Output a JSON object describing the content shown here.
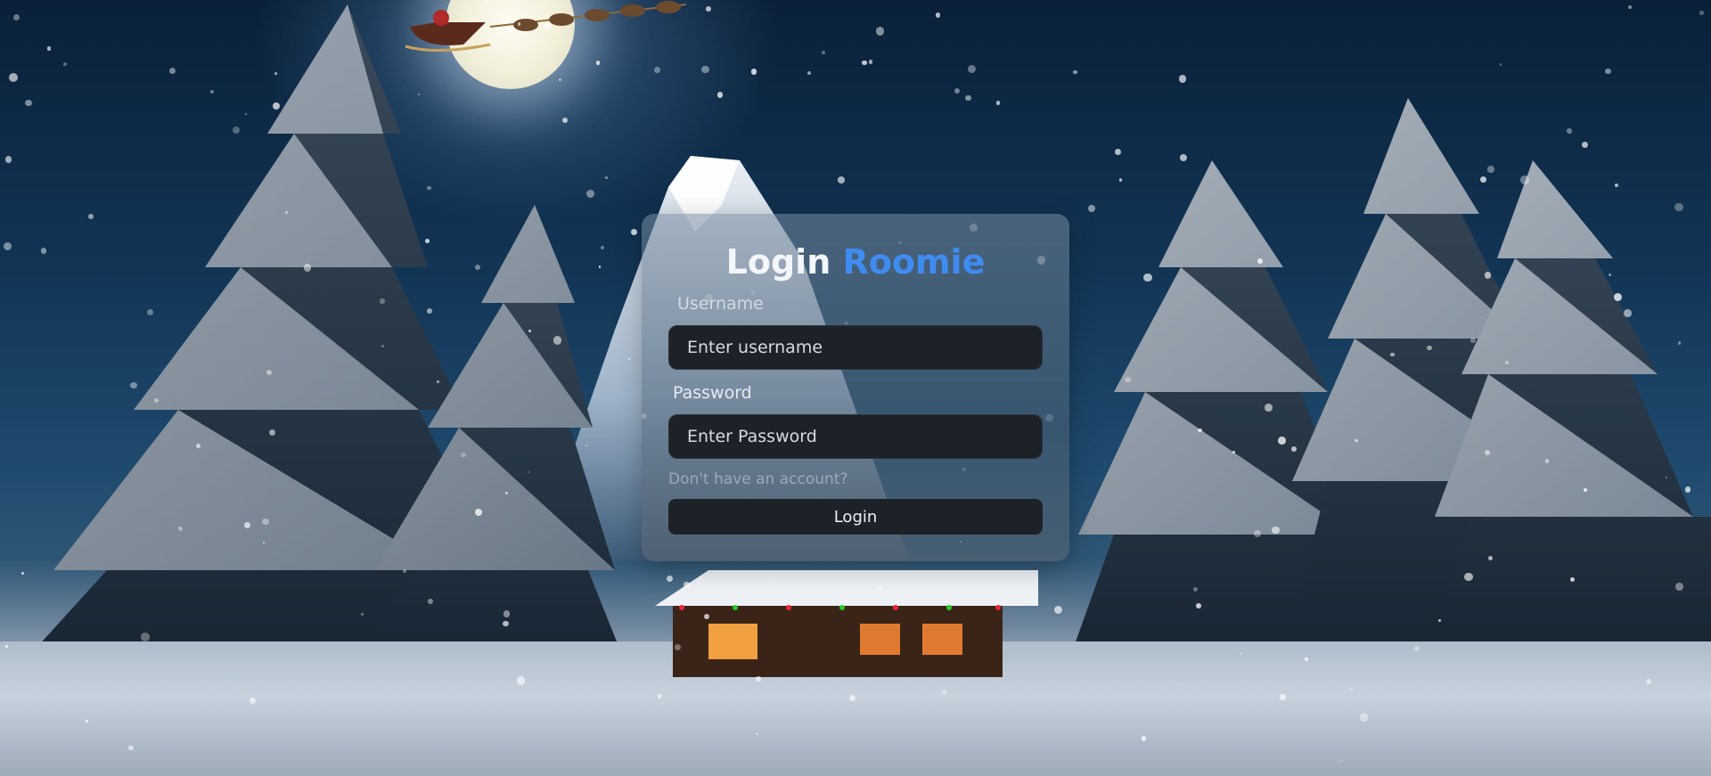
{
  "login_card": {
    "title_prefix": "Login",
    "title_brand": "Roomie",
    "username_label": "Username",
    "username_placeholder": "Enter username",
    "password_label": "Password",
    "password_placeholder": "Enter Password",
    "signup_link": "Don't have an account?",
    "login_button": "Login"
  },
  "colors": {
    "brand_accent": "#3f8cf1",
    "input_background": "#1d2229",
    "card_tint": "#5a6e82"
  },
  "background": {
    "theme": "snowy-night-christmas-scene",
    "icons": [
      "moon-icon",
      "sleigh-icon",
      "mountain-icon",
      "pine-tree-icon",
      "cabin-icon",
      "snowflake-icon"
    ]
  }
}
